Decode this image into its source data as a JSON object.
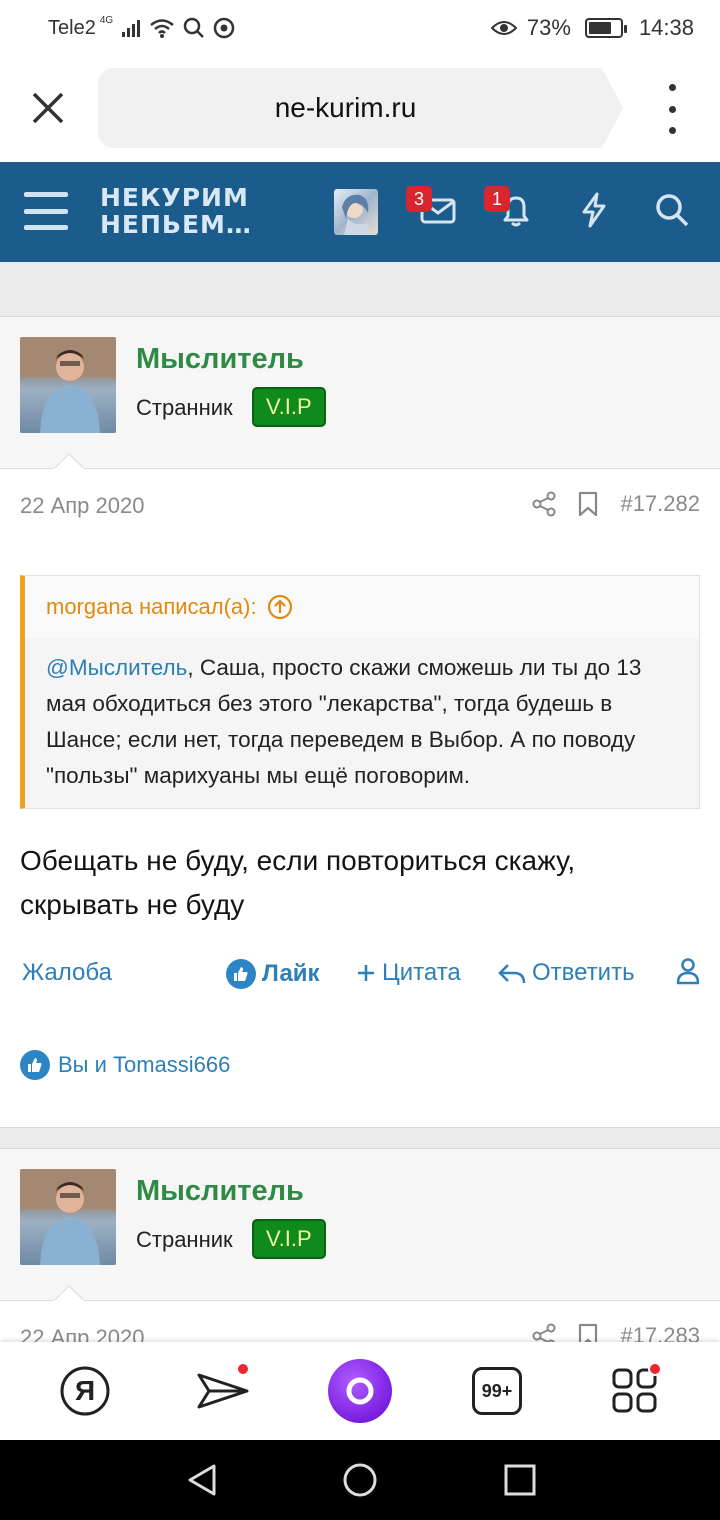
{
  "status_bar": {
    "carrier": "Tele2",
    "network": "4G",
    "battery_percent": "73%",
    "battery_level": 0.73,
    "time": "14:38"
  },
  "browser": {
    "url": "ne-kurim.ru"
  },
  "forum": {
    "logo_line1": "НЕКУРИМ",
    "logo_line2": "НЕПЬЕМ…",
    "messages_count": "3",
    "alerts_count": "1"
  },
  "posts": [
    {
      "author": "Мыслитель",
      "user_title": "Странник",
      "badge": "V.I.P",
      "date": "22 Апр 2020",
      "number": "#17.282",
      "quote": {
        "author_line": "morgana написал(а):",
        "mention": "@Мыслитель",
        "text": ", Саша, просто скажи сможешь ли ты до 13 мая обходиться без этого \"лекарства\", тогда будешь в Шансе; если нет, тогда переведем в Выбор. А по поводу \"пользы\" марихуаны мы ещё поговорим."
      },
      "text": "Обещать не буду, если повториться скажу, скрывать не буду",
      "actions": {
        "report": "Жалоба",
        "like": "Лайк",
        "quote": "Цитата",
        "reply": "Ответить"
      },
      "likes_text": "Вы и Tomassi666"
    },
    {
      "author": "Мыслитель",
      "user_title": "Странник",
      "badge": "V.I.P",
      "date": "22 Апр 2020",
      "number": "#17.283"
    }
  ],
  "yandex_bar": {
    "yandex_label": "Я",
    "tabs_label": "99+"
  },
  "colors": {
    "forum_header": "#1b5c8c",
    "username": "#2f8b44",
    "vip_badge": "#0f8a1c",
    "link": "#2d7fb8",
    "quote_accent": "#f0a020",
    "badge_red": "#d9262e",
    "alice": "#8a2be2"
  }
}
